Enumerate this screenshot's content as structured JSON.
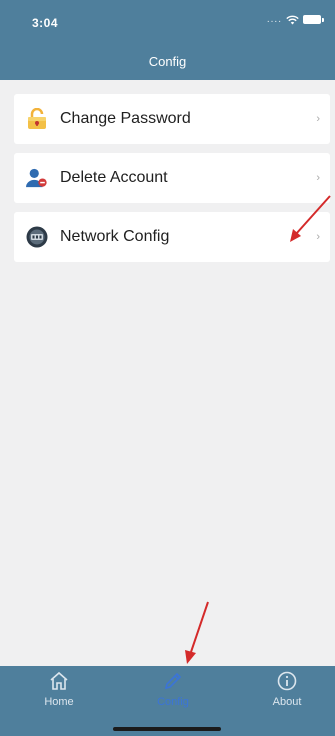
{
  "status_bar": {
    "time": "3:04",
    "signal_dots": "....",
    "wifi_icon": "wifi-icon",
    "battery_icon": "battery-icon"
  },
  "header": {
    "title": "Config"
  },
  "menu": {
    "items": [
      {
        "label": "Change Password",
        "icon": "lock-icon"
      },
      {
        "label": "Delete Account",
        "icon": "user-remove-icon"
      },
      {
        "label": "Network Config",
        "icon": "network-icon"
      }
    ],
    "chevron": "›"
  },
  "tabbar": {
    "tabs": [
      {
        "label": "Home",
        "icon": "home-icon",
        "active": false
      },
      {
        "label": "Config",
        "icon": "pencil-icon",
        "active": true
      },
      {
        "label": "About",
        "icon": "info-icon",
        "active": false
      }
    ]
  },
  "colors": {
    "header_bg": "#4f7f9c",
    "list_bg": "#f0f0f1",
    "active_tab": "#3b74d8",
    "annotation_arrow": "#d42a2a"
  }
}
